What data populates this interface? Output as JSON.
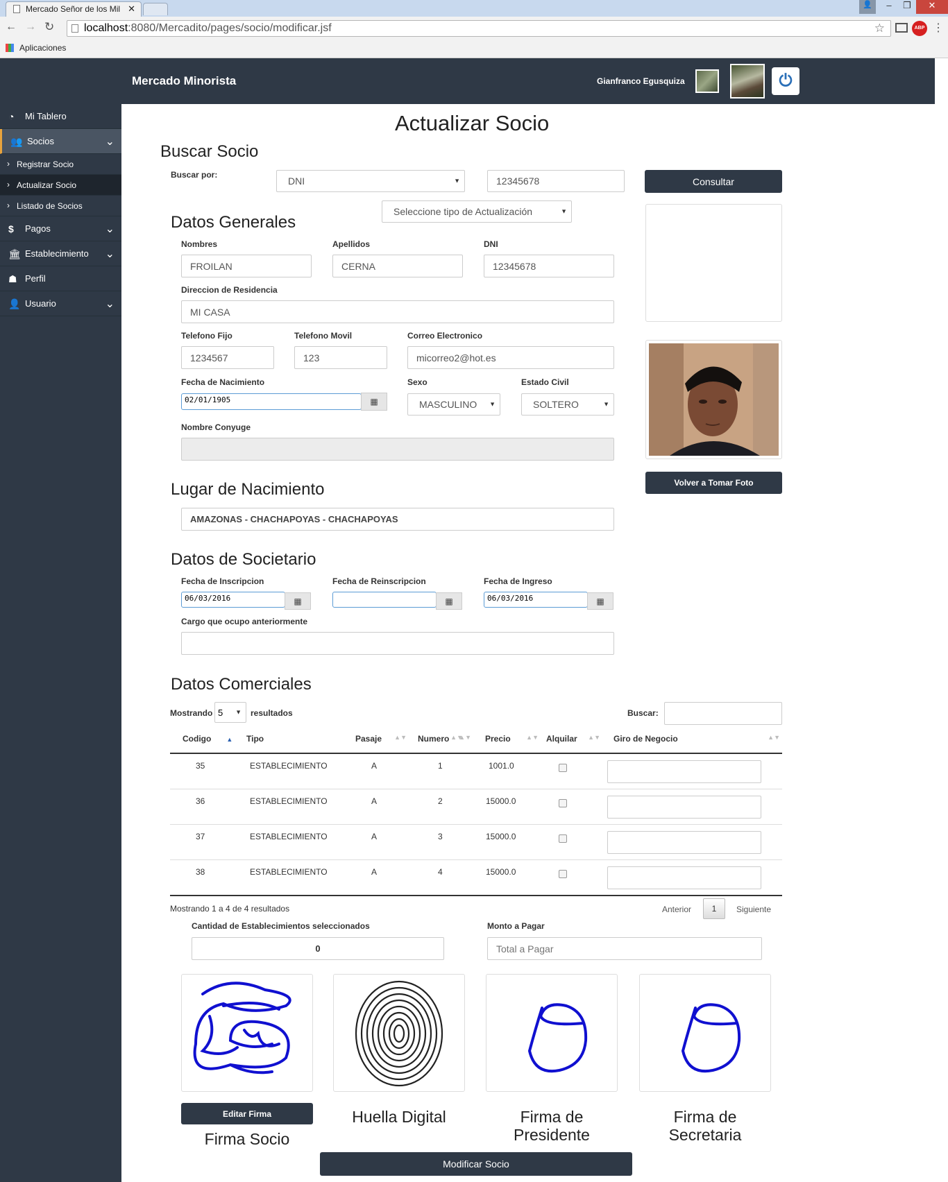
{
  "browser": {
    "tab_title": "Mercado Señor de los Mil",
    "url_host": "localhost",
    "url_rest": ":8080/Mercadito/pages/socio/modificar.jsf",
    "bookmarks": "Aplicaciones"
  },
  "nav": {
    "brand": "Mercado Minorista",
    "user": "Gianfranco Egusquiza"
  },
  "sidebar": {
    "tablero": "Mi Tablero",
    "socios": "Socios",
    "registrar": "Registrar Socio",
    "actualizar": "Actualizar Socio",
    "listado": "Listado de Socios",
    "pagos": "Pagos",
    "establecimiento": "Establecimiento",
    "perfil": "Perfil",
    "usuario": "Usuario"
  },
  "page": {
    "title": "Actualizar Socio",
    "buscar_title": "Buscar Socio",
    "buscar_por": "Buscar por:",
    "buscar_tipo": "DNI",
    "buscar_valor": "12345678",
    "consultar": "Consultar",
    "tipo_actualizacion": "Seleccione tipo de Actualización",
    "volver_foto": "Volver a Tomar Foto"
  },
  "generales": {
    "title": "Datos Generales",
    "nombres_lbl": "Nombres",
    "nombres": "FROILAN",
    "apellidos_lbl": "Apellidos",
    "apellidos": "CERNA",
    "dni_lbl": "DNI",
    "dni": "12345678",
    "direccion_lbl": "Direccion de Residencia",
    "direccion": "MI CASA",
    "tel_fijo_lbl": "Telefono Fijo",
    "tel_fijo": "1234567",
    "tel_movil_lbl": "Telefono Movil",
    "tel_movil": "123",
    "correo_lbl": "Correo Electronico",
    "correo": "micorreo2@hot.es",
    "nac_lbl": "Fecha de Nacimiento",
    "nac": "02/01/1905",
    "sexo_lbl": "Sexo",
    "sexo": "MASCULINO",
    "civil_lbl": "Estado Civil",
    "civil": "SOLTERO",
    "conyuge_lbl": "Nombre Conyuge"
  },
  "lugar": {
    "title": "Lugar de Nacimiento",
    "valor": "AMAZONAS - CHACHAPOYAS - CHACHAPOYAS"
  },
  "societario": {
    "title": "Datos de Societario",
    "inscripcion_lbl": "Fecha de Inscripcion",
    "inscripcion": "06/03/2016",
    "reinscripcion_lbl": "Fecha de Reinscripcion",
    "ingreso_lbl": "Fecha de Ingreso",
    "ingreso": "06/03/2016",
    "cargo_lbl": "Cargo que ocupo anteriormente"
  },
  "comerciales": {
    "title": "Datos Comerciales",
    "mostrando": "Mostrando",
    "page_size": "5",
    "resultados": "resultados",
    "buscar": "Buscar:",
    "headers": [
      "Codigo",
      "Tipo",
      "Pasaje",
      "Numero",
      "Precio",
      "Alquilar",
      "Giro de Negocio"
    ],
    "rows": [
      {
        "codigo": "35",
        "tipo": "ESTABLECIMIENTO",
        "pasaje": "A",
        "numero": "1",
        "precio": "1001.0"
      },
      {
        "codigo": "36",
        "tipo": "ESTABLECIMIENTO",
        "pasaje": "A",
        "numero": "2",
        "precio": "15000.0"
      },
      {
        "codigo": "37",
        "tipo": "ESTABLECIMIENTO",
        "pasaje": "A",
        "numero": "3",
        "precio": "15000.0"
      },
      {
        "codigo": "38",
        "tipo": "ESTABLECIMIENTO",
        "pasaje": "A",
        "numero": "4",
        "precio": "15000.0"
      }
    ],
    "info": "Mostrando 1 a 4 de 4 resultados",
    "anterior": "Anterior",
    "page": "1",
    "siguiente": "Siguiente",
    "cantidad_lbl": "Cantidad de Establecimientos seleccionados",
    "cantidad": "0",
    "monto_lbl": "Monto a Pagar",
    "monto_placeholder": "Total a Pagar"
  },
  "firmas": {
    "editar": "Editar Firma",
    "socio": "Firma Socio",
    "huella": "Huella Digital",
    "presidente_1": "Firma de",
    "presidente_2": "Presidente",
    "secretaria_1": "Firma de",
    "secretaria_2": "Secretaria"
  },
  "submit": "Modificar Socio",
  "colors": {
    "nav": "#2f3946",
    "sidebar_active": "#4a5563",
    "accent": "#e8a33d",
    "ink": "#1010d0"
  }
}
